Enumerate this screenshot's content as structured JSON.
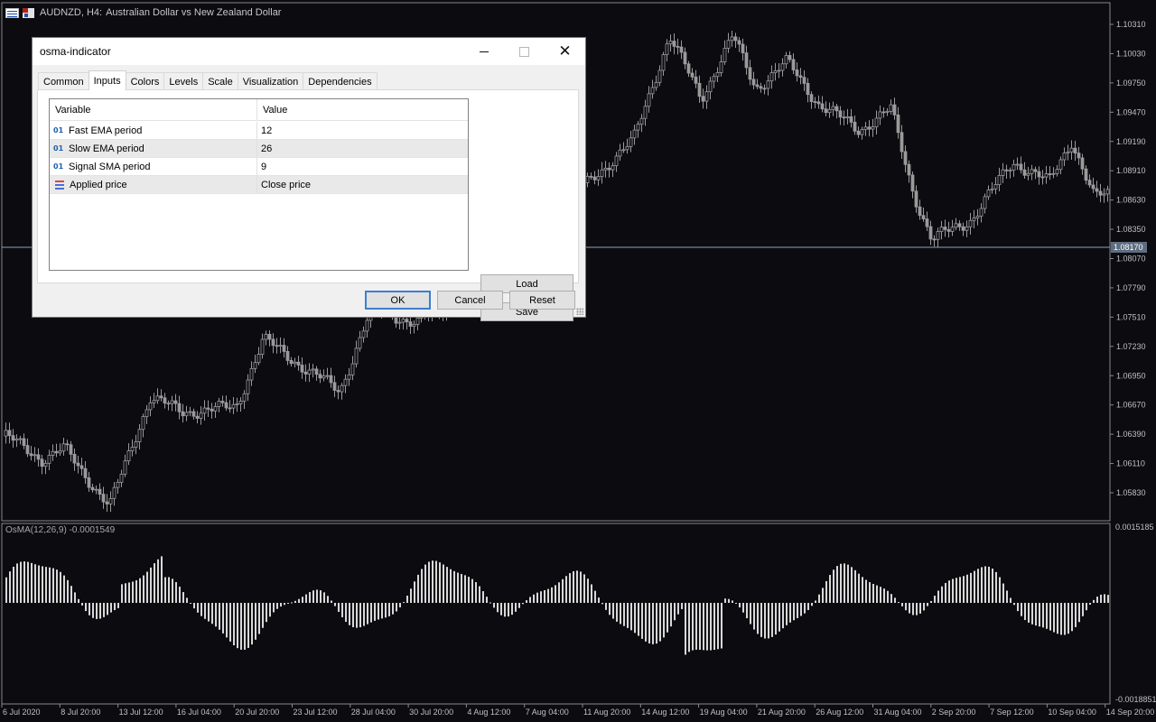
{
  "chart": {
    "symbol": "AUDNZD, H4:",
    "description": "Australian Dollar vs New Zealand Dollar",
    "current_price": "1.08170",
    "osma_label": "OsMA(12,26,9) -0.0001549",
    "price_axis": [
      "1.10310",
      "1.10030",
      "1.09750",
      "1.09470",
      "1.09190",
      "1.08910",
      "1.08630",
      "1.08350",
      "1.08070",
      "1.07790",
      "1.07510",
      "1.07230",
      "1.06950",
      "1.06670",
      "1.06390",
      "1.06110",
      "1.05830"
    ],
    "osma_axis": [
      "0.0015185",
      "-0.0018851"
    ],
    "time_axis": [
      "6 Jul 2020",
      "8 Jul 20:00",
      "13 Jul 12:00",
      "16 Jul 04:00",
      "20 Jul 20:00",
      "23 Jul 12:00",
      "28 Jul 04:00",
      "30 Jul 20:00",
      "4 Aug 12:00",
      "7 Aug 04:00",
      "11 Aug 20:00",
      "14 Aug 12:00",
      "19 Aug 04:00",
      "21 Aug 20:00",
      "26 Aug 12:00",
      "31 Aug 04:00",
      "2 Sep 20:00",
      "7 Sep 12:00",
      "10 Sep 04:00",
      "14 Sep 20:00"
    ],
    "colors": {
      "background": "#0b0b10",
      "candle": "#9a9a9a",
      "histogram": "#d8d8d8",
      "grid_line": "#8ea3b8"
    }
  },
  "dialog": {
    "title": "osma-indicator",
    "tabs": [
      "Common",
      "Inputs",
      "Colors",
      "Levels",
      "Scale",
      "Visualization",
      "Dependencies"
    ],
    "active_tab": "Inputs",
    "headers": {
      "variable": "Variable",
      "value": "Value"
    },
    "rows": [
      {
        "icon": "01",
        "variable": "Fast EMA period",
        "value": "12"
      },
      {
        "icon": "01",
        "variable": "Slow EMA period",
        "value": "26"
      },
      {
        "icon": "01",
        "variable": "Signal SMA period",
        "value": "9"
      },
      {
        "icon": "enum-icon",
        "variable": "Applied price",
        "value": "Close price"
      }
    ],
    "buttons": {
      "load": "Load",
      "save": "Save",
      "ok": "OK",
      "cancel": "Cancel",
      "reset": "Reset"
    },
    "close_glyph": "✕"
  }
}
